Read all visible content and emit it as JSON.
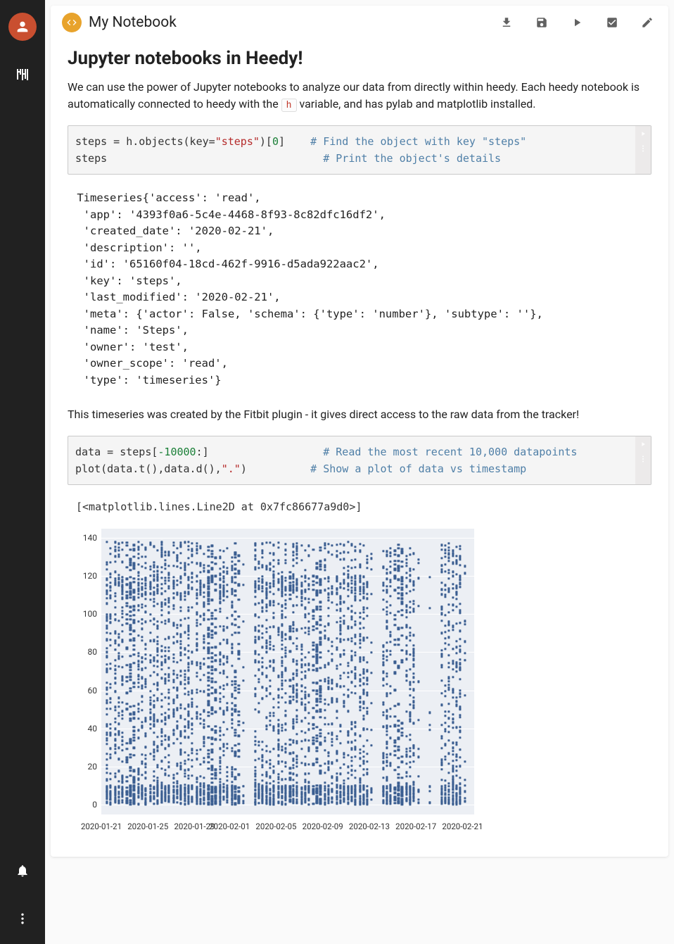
{
  "sidebar": {
    "avatar_icon": "person-icon",
    "tuner_icon": "tuner-icon",
    "bell_icon": "bell-icon",
    "more_icon": "more-vert-icon"
  },
  "header": {
    "title": "My Notebook",
    "badge": "code-icon",
    "actions": {
      "download": "download-icon",
      "save": "save-icon",
      "run": "play-icon",
      "check": "check-box-icon",
      "edit": "edit-icon"
    }
  },
  "body": {
    "h2": "Jupyter notebooks in Heedy!",
    "p1a": "We can use the power of Jupyter notebooks to analyze our data from directly within heedy. Each heedy notebook is automatically connected to heedy with the ",
    "p1_code": "h",
    "p1b": " variable, and has pylab and matplotlib installed.",
    "code1": {
      "l1a": "steps = h.objects(key=",
      "l1s": "\"steps\"",
      "l1b": ")[",
      "l1n": "0",
      "l1c": "]",
      "l1pad": "    ",
      "l1cmt": "# Find the object with key \"steps\"",
      "l2a": "steps",
      "l2pad": "                                  ",
      "l2cmt": "# Print the object's details"
    },
    "output1": " Timeseries{'access': 'read',\n  'app': '4393f0a6-5c4e-4468-8f93-8c82dfc16df2',\n  'created_date': '2020-02-21',\n  'description': '',\n  'id': '65160f04-18cd-462f-9916-d5ada922aac2',\n  'key': 'steps',\n  'last_modified': '2020-02-21',\n  'meta': {'actor': False, 'schema': {'type': 'number'}, 'subtype': ''},\n  'name': 'Steps',\n  'owner': 'test',\n  'owner_scope': 'read',\n  'type': 'timeseries'}",
    "p2": "This timeseries was created by the Fitbit plugin - it gives direct access to the raw data from the tracker!",
    "code2": {
      "l1a": "data = steps[",
      "l1n": "-10000",
      "l1b": ":]",
      "l1pad": "                  ",
      "l1cmt": "# Read the most recent 10,000 datapoints",
      "l2a": "plot(data.t(),data.d(),",
      "l2s": "\".\"",
      "l2b": ")",
      "l2pad": "          ",
      "l2cmt": "# Show a plot of data vs timestamp"
    },
    "output2": "[<matplotlib.lines.Line2D at 0x7fc86677a9d0>]"
  },
  "chart_data": {
    "type": "scatter",
    "title": "",
    "xlabel": "",
    "ylabel": "",
    "ylim": [
      -5,
      145
    ],
    "y_ticks": [
      0,
      20,
      40,
      60,
      80,
      100,
      120,
      140
    ],
    "x_ticks": [
      "2020-01-21",
      "2020-01-25",
      "2020-01-29",
      "2020-02-01",
      "2020-02-05",
      "2020-02-09",
      "2020-02-13",
      "2020-02-17",
      "2020-02-21"
    ],
    "x_range_days": [
      0,
      32
    ],
    "description": "Dense scatter of step counts 0–140 over ~32 daily columns from 2020-01-21 to 2020-02-21, with sparser columns around days 12, 23, 27–28, and 31."
  }
}
